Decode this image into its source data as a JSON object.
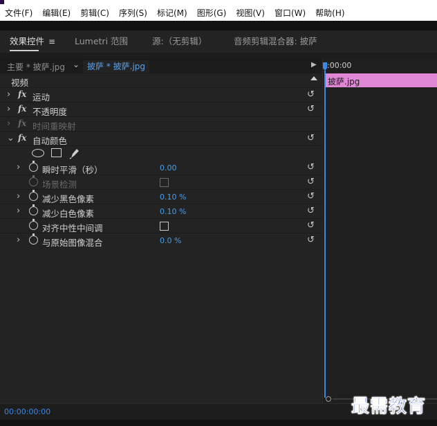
{
  "menubar": {
    "items": [
      "文件(F)",
      "编辑(E)",
      "剪辑(C)",
      "序列(S)",
      "标记(M)",
      "图形(G)",
      "视图(V)",
      "窗口(W)",
      "帮助(H)"
    ]
  },
  "panel_tabs": {
    "effect_controls": "效果控件",
    "lumetri": "Lumetri 范围",
    "source": "源:（无剪辑）",
    "audio_mixer": "音频剪辑混合器: 披萨"
  },
  "source_row": {
    "main": "主要 * 披萨.jpg",
    "clip": "披萨 * 披萨.jpg"
  },
  "section": {
    "video": "视频"
  },
  "effects": {
    "motion": "运动",
    "opacity": "不透明度",
    "time_remap": "时间重映射",
    "auto_color": "自动颜色"
  },
  "params": [
    {
      "label": "瞬时平滑（秒）",
      "value": "0.00"
    },
    {
      "label": "场景检测"
    },
    {
      "label": "减少黑色像素",
      "value": "0.10 %"
    },
    {
      "label": "减少白色像素",
      "value": "0.10 %"
    },
    {
      "label": "对齐中性中间调"
    },
    {
      "label": "与原始图像混合",
      "value": "0.0 %"
    }
  ],
  "timeline": {
    "time": ":00:00",
    "clip_label": "披萨.jpg"
  },
  "status": {
    "timecode": "00:00:00:00"
  },
  "watermark": "最需教育",
  "colors": {
    "accent_blue": "#3a88e8",
    "clip_pink": "#e087d6",
    "value_blue": "#4d9de6"
  }
}
